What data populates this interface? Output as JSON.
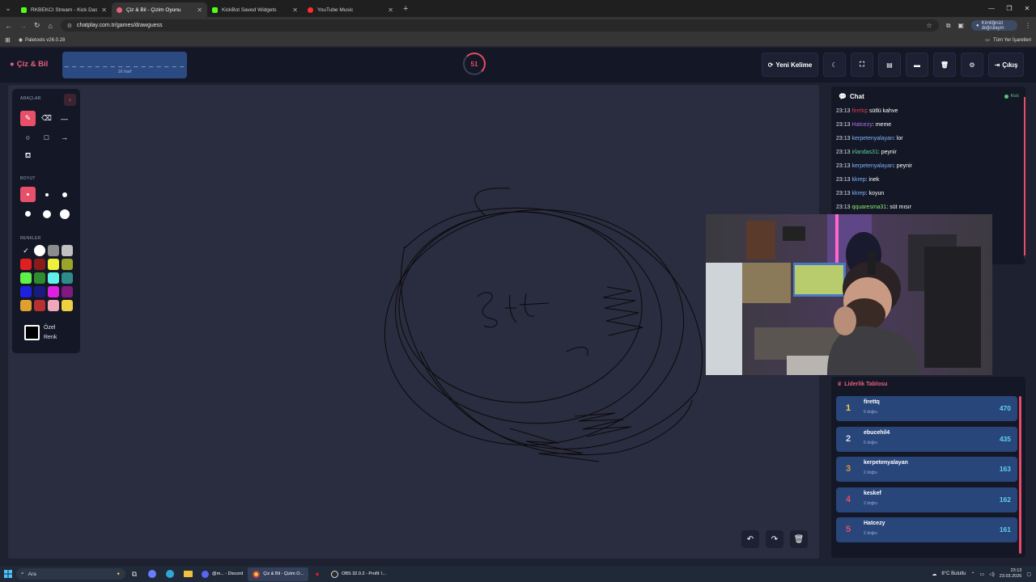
{
  "browser": {
    "tabs": [
      {
        "title": "RKBEKCI Stream - Kick Dashbo...",
        "color": "#53fc18"
      },
      {
        "title": "Çiz & Bil - Çizim Oyunu",
        "color": "#e8607a",
        "active": true
      },
      {
        "title": "KickBot Saved Widgets",
        "color": "#53fc18"
      },
      {
        "title": "YouTube Music",
        "color": "#ff2d2d"
      }
    ],
    "url": "chatplay.com.tr/games/drawguess",
    "profile_label": "Kimliğinizi doğrulayın",
    "bookmark": "Paletools v26.0.28",
    "all_bookmarks": "Tüm Yer İşaretleri"
  },
  "header": {
    "brand": "Çiz & Bil",
    "word_mask": "_ _ _ _ _ _ _ _ _ _ _ _ _ _ _ _",
    "letter_count": "16 harf",
    "timer": "51",
    "new_word": "Yeni Kelime",
    "exit": "Çıkış"
  },
  "tools": {
    "section_tools": "ARAÇLAR",
    "section_size": "BOYUT",
    "section_colors": "RENKLER",
    "custom_color": "Özel Renk",
    "colors": [
      [
        "#000000",
        "#ffffff",
        "#8c8c8c",
        "#c0c0c0"
      ],
      [
        "#e02020",
        "#8b1a1a",
        "#eef03a",
        "#9aa52a"
      ],
      [
        "#5ff04a",
        "#2e8b2e",
        "#5ff0e8",
        "#2e8b8b"
      ],
      [
        "#2020e0",
        "#1a1a80",
        "#e020e0",
        "#801a80"
      ],
      [
        "#e0a030",
        "#b83030",
        "#f0a8b8",
        "#f0d040"
      ]
    ]
  },
  "chat": {
    "title": "Chat",
    "platform": "Kick",
    "messages": [
      {
        "time": "23:13",
        "user": "firettq",
        "color": "#d23a4a",
        "text": "sütlü kahve"
      },
      {
        "time": "23:13",
        "user": "Hatcezy",
        "color": "#b66ee8",
        "text": "meme"
      },
      {
        "time": "23:13",
        "user": "kerpetenyalayan",
        "color": "#7fb2ff",
        "text": "lor"
      },
      {
        "time": "23:13",
        "user": "irlandas31",
        "color": "#5fcf9a",
        "text": "peynir"
      },
      {
        "time": "23:13",
        "user": "kerpetenyalayan",
        "color": "#7fb2ff",
        "text": "peynir"
      },
      {
        "time": "23:13",
        "user": "kkrep",
        "color": "#7fb2ff",
        "text": "inek"
      },
      {
        "time": "23:13",
        "user": "kkrep",
        "color": "#7fb2ff",
        "text": "koyun"
      },
      {
        "time": "23:13",
        "user": "qquaresma31",
        "color": "#8ee86a",
        "text": "süt mısır"
      }
    ]
  },
  "leaderboard": {
    "title": "Liderlik Tablosu",
    "rows": [
      {
        "rank": "1",
        "name": "firettq",
        "sub": "6 doğru",
        "score": "470",
        "rank_color": "#f5d142"
      },
      {
        "rank": "2",
        "name": "ebucehil4",
        "sub": "6 doğru",
        "score": "435",
        "rank_color": "#d6dbe6"
      },
      {
        "rank": "3",
        "name": "kerpetenyalayan",
        "sub": "2 doğru",
        "score": "163",
        "rank_color": "#e0913a"
      },
      {
        "rank": "4",
        "name": "keskef",
        "sub": "2 doğru",
        "score": "162",
        "rank_color": "#e84b63"
      },
      {
        "rank": "5",
        "name": "Hatcezy",
        "sub": "2 doğru",
        "score": "161",
        "rank_color": "#e84b63"
      }
    ]
  },
  "taskbar": {
    "search": "Ara",
    "apps": [
      {
        "label": "@m... - Discord"
      },
      {
        "label": "Çiz & Bil - Çizim O...",
        "active": true
      },
      {
        "label": "OBS 32.0.2 - Profil: I..."
      }
    ],
    "weather": "8°C  Bulutlu",
    "time": "23:13",
    "date": "23.03.2026"
  }
}
